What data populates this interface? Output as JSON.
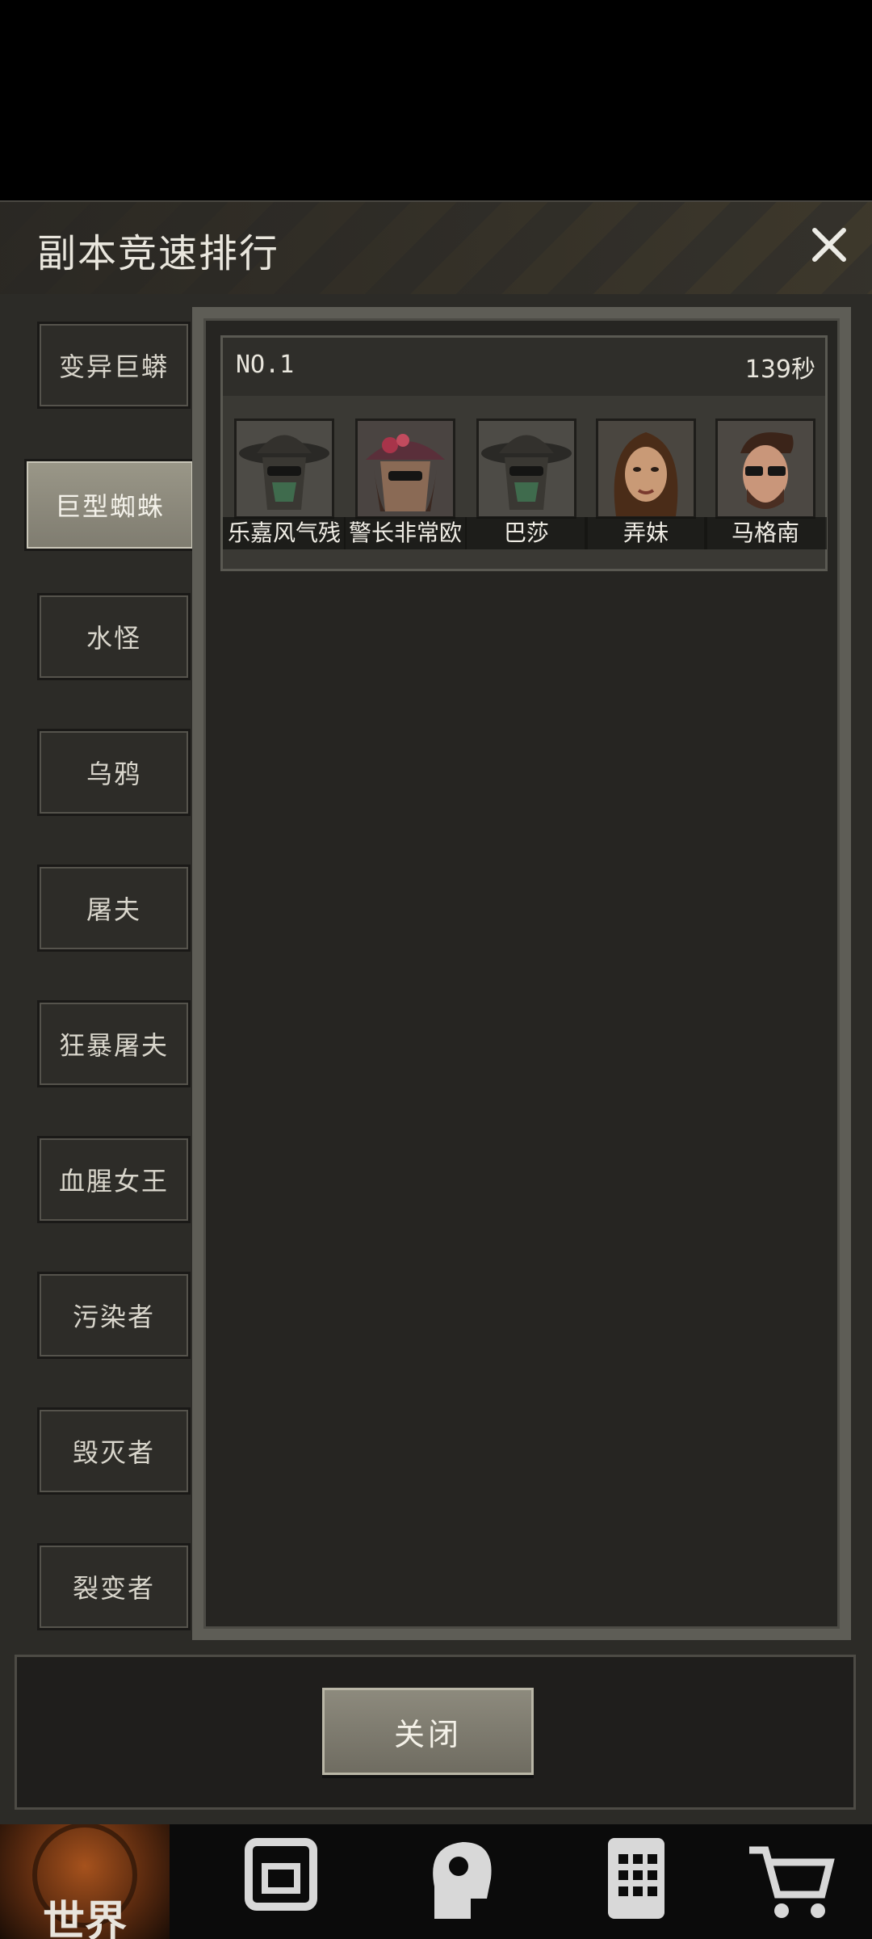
{
  "dialog": {
    "title": "副本竞速排行",
    "close_label": "关闭"
  },
  "tabs": [
    {
      "label": "变异巨蟒",
      "active": false
    },
    {
      "label": "巨型蜘蛛",
      "active": true
    },
    {
      "label": "水怪",
      "active": false
    },
    {
      "label": "乌鸦",
      "active": false
    },
    {
      "label": "屠夫",
      "active": false
    },
    {
      "label": "狂暴屠夫",
      "active": false
    },
    {
      "label": "血腥女王",
      "active": false
    },
    {
      "label": "污染者",
      "active": false
    },
    {
      "label": "毁灭者",
      "active": false
    },
    {
      "label": "裂变者",
      "active": false
    }
  ],
  "ranking": {
    "rank": "NO.1",
    "time": "139秒",
    "members": [
      {
        "name": "乐嘉风气残",
        "avatar": "masked-hat-avatar"
      },
      {
        "name": "警长非常欧",
        "avatar": "flower-hat-avatar"
      },
      {
        "name": "巴莎",
        "avatar": "masked-hat-avatar"
      },
      {
        "name": "弄妹",
        "avatar": "woman-avatar"
      },
      {
        "name": "马格南",
        "avatar": "sunglasses-man-avatar"
      }
    ]
  },
  "bottom_nav": {
    "world_label": "世界",
    "items": [
      "globe-icon",
      "backpack-icon",
      "head-icon",
      "phone-icon",
      "cart-icon"
    ]
  },
  "colors": {
    "panel_bg": "#262522",
    "tab_active": "#8f8c7f",
    "button_bg": "#7d7a6e"
  }
}
